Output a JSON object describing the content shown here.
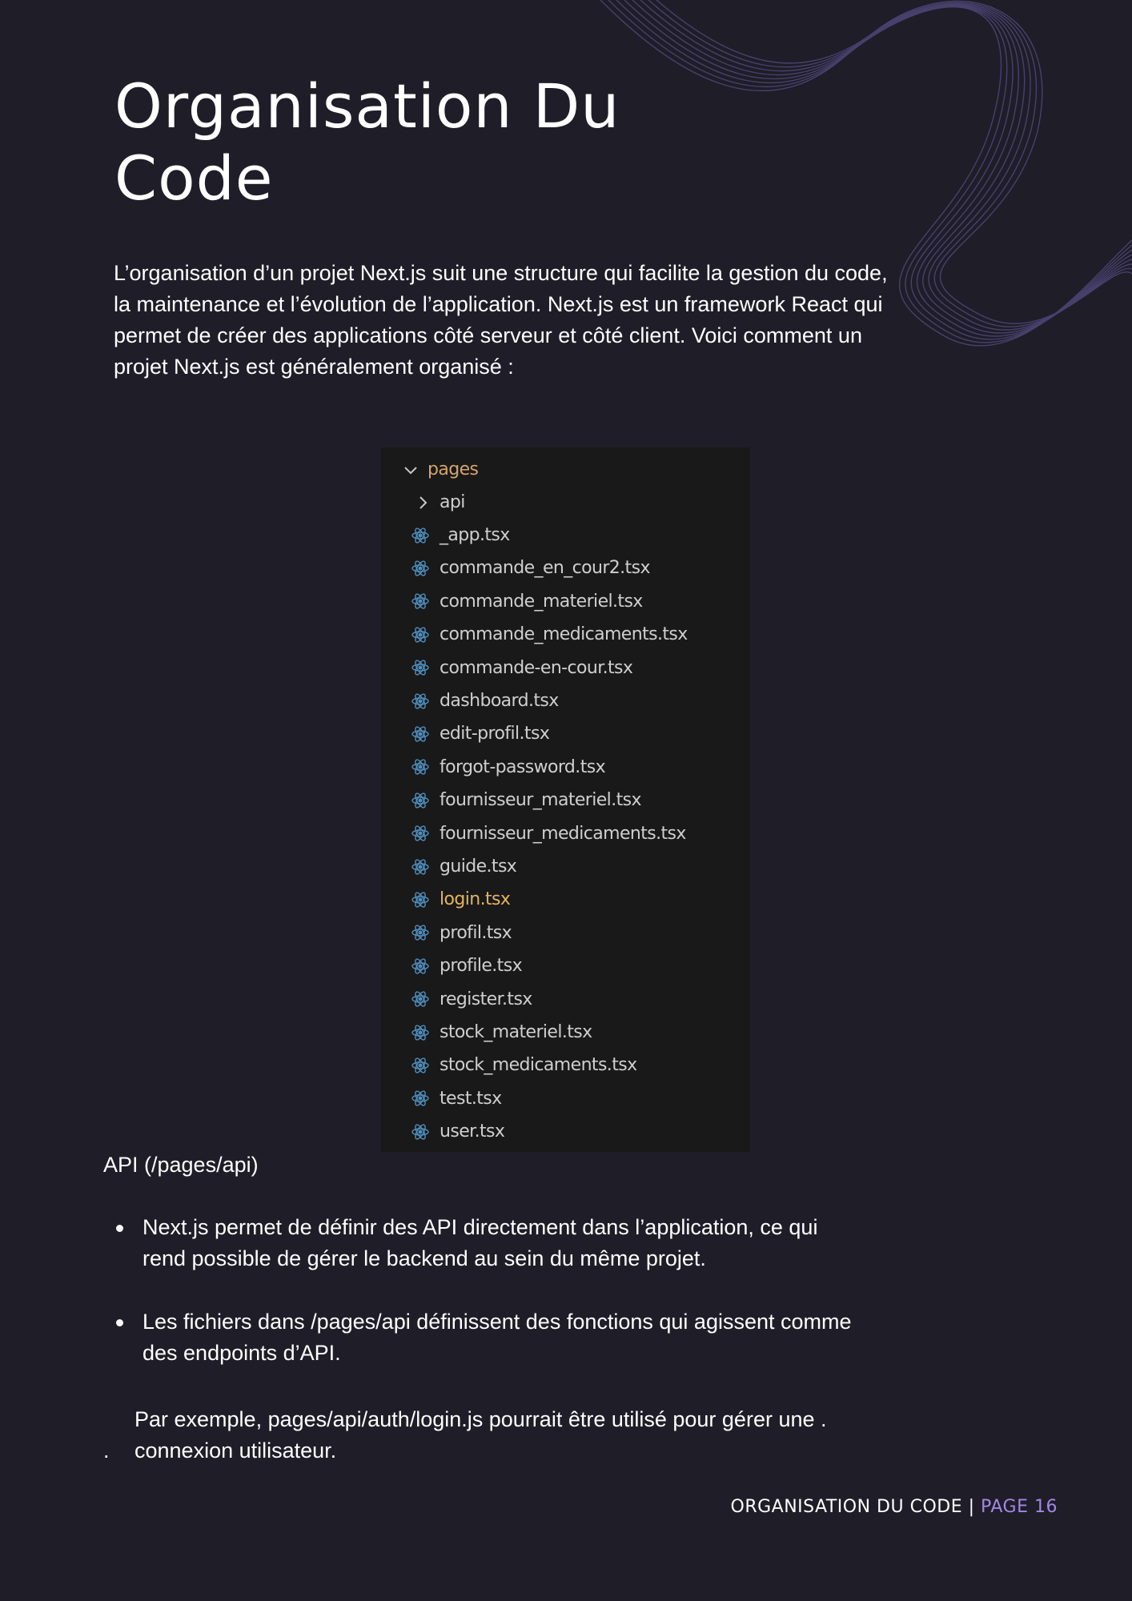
{
  "page": {
    "title": "Organisation Du Code",
    "intro": "L’organisation d’un projet Next.js suit une structure qui facilite la gestion du code, la maintenance et l’évolution de l’application. Next.js est un framework React qui permet de créer des applications côté serveur et côté client. Voici comment un projet Next.js est généralement organisé :"
  },
  "explorer": {
    "root_folder": "pages",
    "subfolder": "api",
    "files": [
      "_app.tsx",
      "commande_en_cour2.tsx",
      "commande_materiel.tsx",
      "commande_medicaments.tsx",
      "commande-en-cour.tsx",
      "dashboard.tsx",
      "edit-profil.tsx",
      "forgot-password.tsx",
      "fournisseur_materiel.tsx",
      "fournisseur_medicaments.tsx",
      "guide.tsx",
      "login.tsx",
      "profil.tsx",
      "profile.tsx",
      "register.tsx",
      "stock_materiel.tsx",
      "stock_medicaments.tsx",
      "test.tsx",
      "user.tsx"
    ],
    "highlighted_file": "login.tsx",
    "file_icon": "react-icon"
  },
  "section": {
    "heading": "API (/pages/api)",
    "bullets": [
      "Next.js permet de définir des API directement dans l’application, ce qui rend possible de gérer le backend au sein du même projet.",
      "Les fichiers dans /pages/api définissent des fonctions qui agissent comme des endpoints d’API."
    ],
    "example": "Par exemple, pages/api/auth/login.js pourrait être utilisé pour gérer une . connexion utilisateur.",
    "stray_dot": "."
  },
  "footer": {
    "section_label": "ORGANISATION DU CODE",
    "separator": "|",
    "page_label": "PAGE 16"
  },
  "colors": {
    "background": "#1f1d28",
    "accent": "#9d8ae6",
    "explorer_bg": "#191919",
    "folder_text": "#d4a56a",
    "react_icon": "#4f8fc0"
  }
}
